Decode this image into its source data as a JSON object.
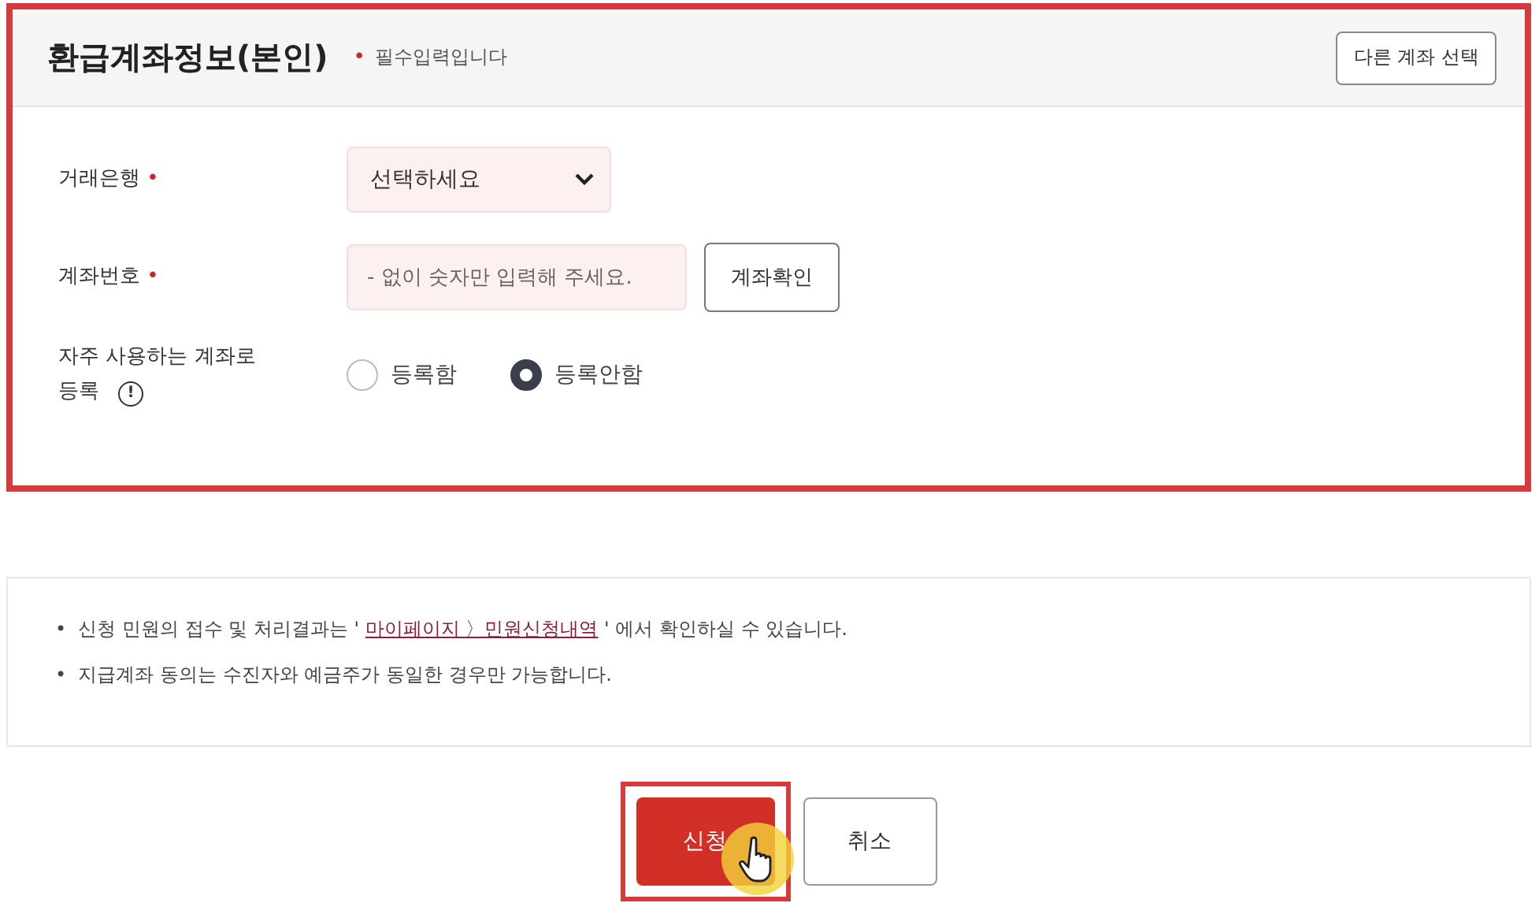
{
  "panel": {
    "title": "환급계좌정보(본인)",
    "required_mark": "•",
    "required_note": "필수입력입니다",
    "other_account_button": "다른 계좌 선택",
    "highlighted": true
  },
  "fields": [
    {
      "kind": "select",
      "label": "거래은행",
      "required_mark": "•",
      "value": "선택하세요"
    },
    {
      "kind": "input",
      "label": "계좌번호",
      "required_mark": "•",
      "placeholder": "- 없이 숫자만 입력해 주세요.",
      "button": "계좌확인"
    },
    {
      "kind": "radio",
      "label": "자주 사용하는 계좌로 등록",
      "info": "!",
      "options": [
        {
          "label": "등록함",
          "selected": false
        },
        {
          "label": "등록안함",
          "selected": true
        }
      ]
    }
  ],
  "notices": [
    {
      "marker": "•",
      "before": "신청 민원의 접수 및 처리결과는 ' ",
      "link": "마이페이지 〉민원신청내역",
      "after": " ' 에서 확인하실 수 있습니다."
    },
    {
      "marker": "•",
      "before": "지급계좌 동의는 수진자와 예금주가 동일한 경우만 가능합니다."
    }
  ],
  "actions": [
    {
      "label": "신청",
      "kind": "primary",
      "highlighted": true,
      "cursor": true
    },
    {
      "label": "취소",
      "kind": "secondary",
      "highlighted": false,
      "cursor": false
    }
  ]
}
